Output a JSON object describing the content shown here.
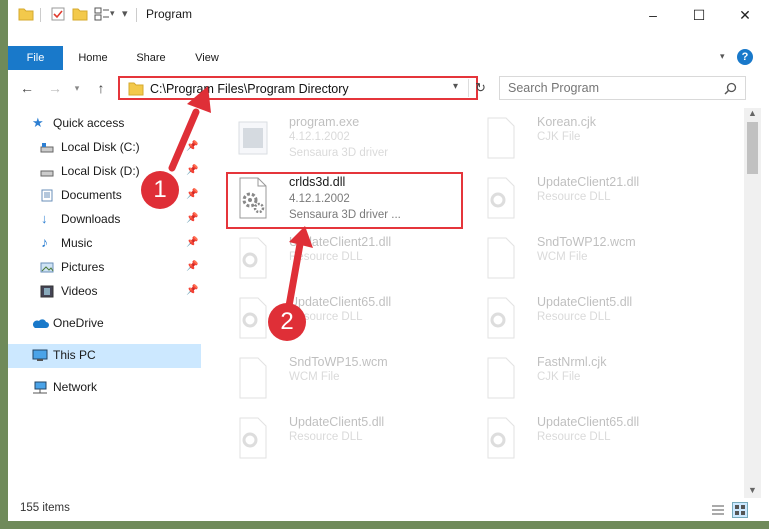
{
  "window": {
    "title": "Program",
    "controls": {
      "minimize": "–",
      "maximize": "☐",
      "close": "✕"
    }
  },
  "ribbon": {
    "tabs": [
      "File",
      "Home",
      "Share",
      "View"
    ]
  },
  "address": {
    "path": "C:\\Program Files\\Program Directory",
    "search_placeholder": "Search Program"
  },
  "sidebar": {
    "items": [
      {
        "label": "Quick access",
        "icon": "star-icon"
      },
      {
        "label": "Local Disk (C:)",
        "icon": "drive-icon",
        "pinned": true
      },
      {
        "label": "Local Disk (D:)",
        "icon": "drive-icon",
        "pinned": true
      },
      {
        "label": "Documents",
        "icon": "documents-icon",
        "pinned": true
      },
      {
        "label": "Downloads",
        "icon": "download-icon",
        "pinned": true
      },
      {
        "label": "Music",
        "icon": "music-icon",
        "pinned": true
      },
      {
        "label": "Pictures",
        "icon": "pictures-icon",
        "pinned": true
      },
      {
        "label": "Videos",
        "icon": "videos-icon",
        "pinned": true
      },
      {
        "label": "OneDrive",
        "icon": "cloud-icon"
      },
      {
        "label": "This PC",
        "icon": "computer-icon",
        "selected": true
      },
      {
        "label": "Network",
        "icon": "network-icon"
      }
    ]
  },
  "files": {
    "left": [
      {
        "name": "program.exe",
        "line2": "4.12.1.2002",
        "line3": "Sensaura 3D driver"
      },
      {
        "name": "crlds3d.dll",
        "line2": "4.12.1.2002",
        "line3": "Sensaura 3D driver ...",
        "highlighted": true
      },
      {
        "name": "UpdateClient21.dll",
        "line2": "Resource DLL"
      },
      {
        "name": "UpdateClient65.dll",
        "line2": "Resource DLL"
      },
      {
        "name": "SndToWP15.wcm",
        "line2": "WCM File"
      },
      {
        "name": "UpdateClient5.dll",
        "line2": "Resource DLL"
      }
    ],
    "right": [
      {
        "name": "Korean.cjk",
        "line2": "CJK File"
      },
      {
        "name": "UpdateClient21.dll",
        "line2": "Resource DLL"
      },
      {
        "name": "SndToWP12.wcm",
        "line2": "WCM File"
      },
      {
        "name": "UpdateClient5.dll",
        "line2": "Resource DLL"
      },
      {
        "name": "FastNrml.cjk",
        "line2": "CJK File"
      },
      {
        "name": "UpdateClient65.dll",
        "line2": "Resource DLL"
      }
    ]
  },
  "status": {
    "count": "155 items"
  },
  "annotations": {
    "step1": "1",
    "step2": "2",
    "color": "#df2f37"
  }
}
